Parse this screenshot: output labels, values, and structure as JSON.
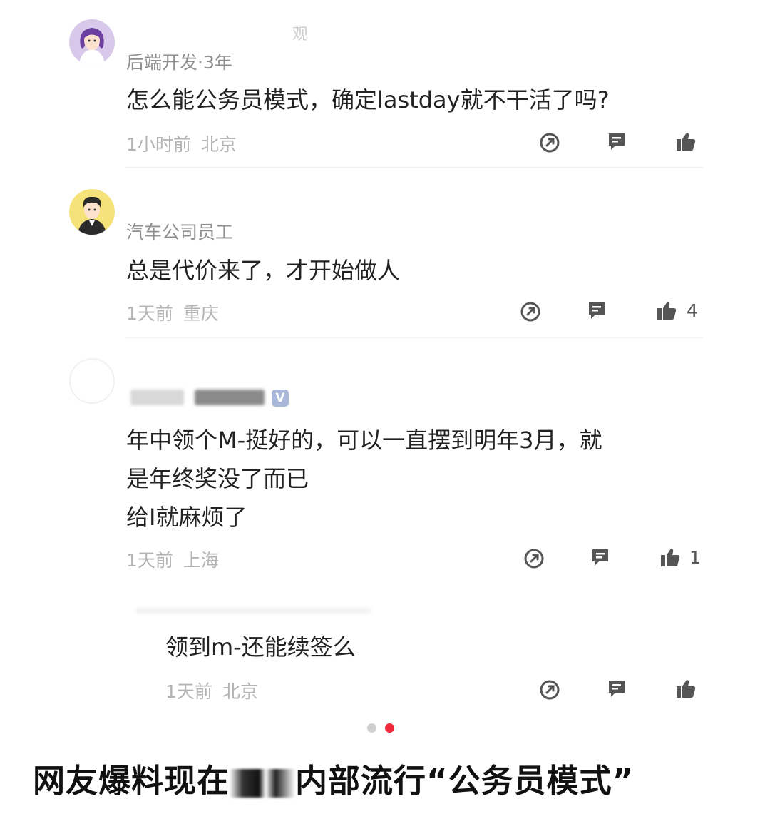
{
  "top_fragment": "观",
  "comments": [
    {
      "author": "后端开发·3年",
      "text_lines": [
        "怎么能公务员模式，确定lastday就不干活了吗?"
      ],
      "time": "1小时前",
      "location": "北京",
      "likes": ""
    },
    {
      "author": "汽车公司员工",
      "text_lines": [
        "总是代价来了，才开始做人"
      ],
      "time": "1天前",
      "location": "重庆",
      "likes": "4"
    },
    {
      "author": "",
      "verified_badge": "V",
      "text_lines": [
        "年中领个M-挺好的，可以一直摆到明年3月，就",
        "是年终奖没了而已",
        "给I就麻烦了"
      ],
      "time": "1天前",
      "location": "上海",
      "likes": "1"
    },
    {
      "author": "",
      "text_lines": [
        "领到m-还能续签么"
      ],
      "time": "1天前",
      "location": "北京",
      "likes": ""
    }
  ],
  "icons": {
    "share": "share-icon",
    "reply": "reply-icon",
    "like": "thumbs-up-icon"
  },
  "colors": {
    "dot_inactive": "#cfcfcf",
    "dot_active": "#f0283c",
    "icon": "#555555"
  },
  "caption": {
    "before": "网友爆料现在",
    "after": "内部流行“公务员模式”"
  }
}
